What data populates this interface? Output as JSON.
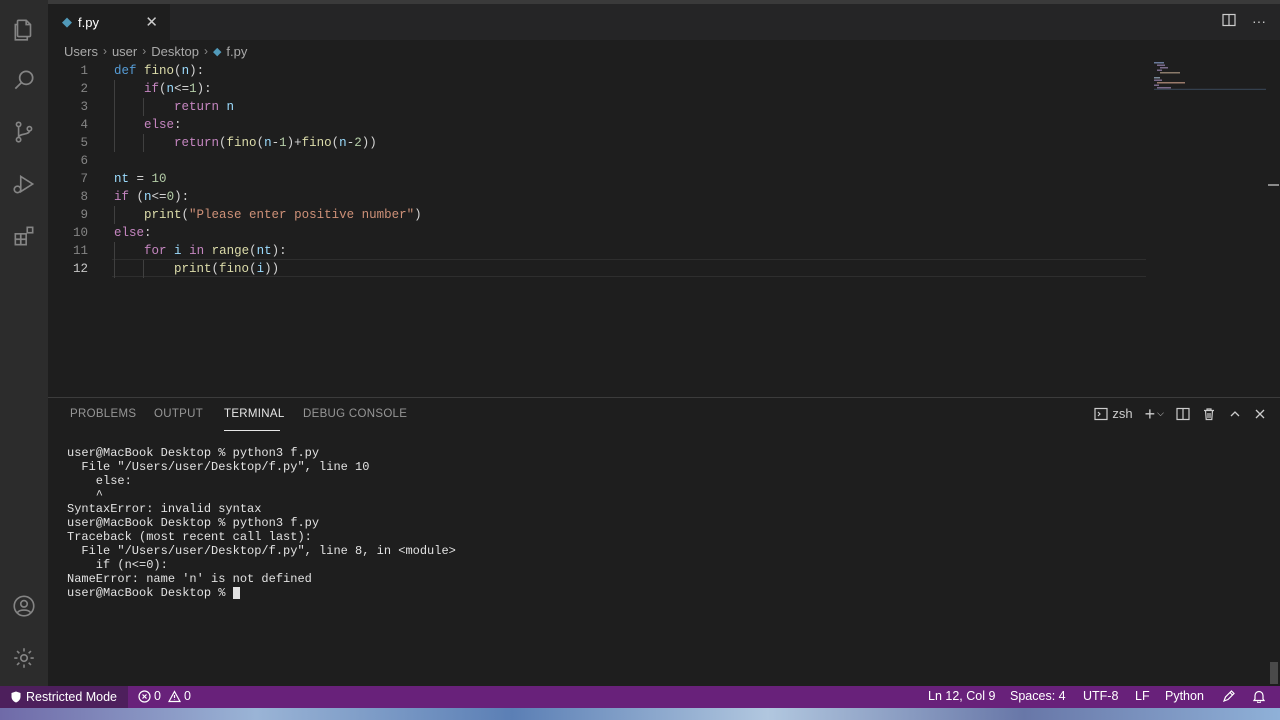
{
  "tab": {
    "icon": "python-file-icon",
    "name": "f.py",
    "close": "✕"
  },
  "breadcrumb": [
    "Users",
    "user",
    "Desktop",
    "f.py"
  ],
  "editor": {
    "line_numbers": [
      "1",
      "2",
      "3",
      "4",
      "5",
      "6",
      "7",
      "8",
      "9",
      "10",
      "11",
      "12"
    ],
    "current_line": 12
  },
  "panel": {
    "tabs": [
      "PROBLEMS",
      "OUTPUT",
      "TERMINAL",
      "DEBUG CONSOLE"
    ],
    "active_tab": "TERMINAL",
    "shell": "zsh"
  },
  "terminal": {
    "lines": [
      "user@MacBook Desktop % python3 f.py",
      "  File \"/Users/user/Desktop/f.py\", line 10",
      "    else:",
      "    ^",
      "SyntaxError: invalid syntax",
      "user@MacBook Desktop % python3 f.py",
      "Traceback (most recent call last):",
      "  File \"/Users/user/Desktop/f.py\", line 8, in <module>",
      "    if (n<=0):",
      "NameError: name 'n' is not defined"
    ],
    "prompt": "user@MacBook Desktop % "
  },
  "status": {
    "restricted": "Restricted Mode",
    "errors": "0",
    "warnings": "0",
    "position": "Ln 12, Col 9",
    "spaces": "Spaces: 4",
    "encoding": "UTF-8",
    "eol": "LF",
    "language": "Python"
  },
  "colors": {
    "status_bar": "#68217a",
    "restricted_bg": "#4d1f5c",
    "editor_bg": "#1e1e1e",
    "keyword": "#569cd6",
    "string": "#ce9178"
  }
}
